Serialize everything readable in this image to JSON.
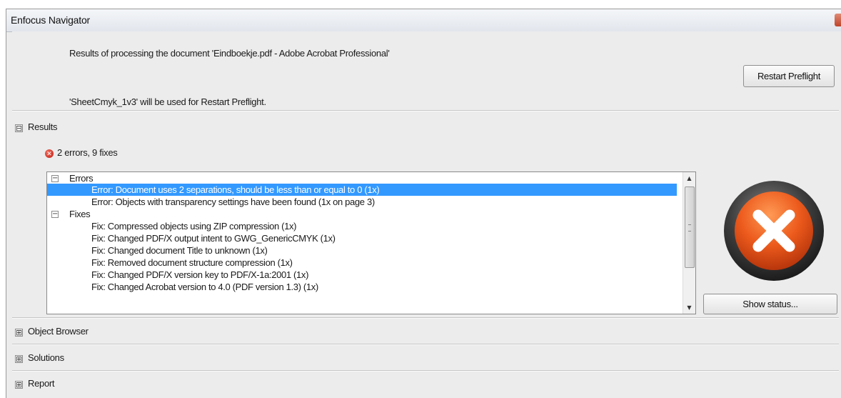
{
  "window": {
    "title": "Enfocus Navigator"
  },
  "header": {
    "document_line": "Results of processing the document 'Eindboekje.pdf - Adobe Acrobat Professional'",
    "profile_line": "'SheetCmyk_1v3' will be used for Restart Preflight.",
    "restart_button": "Restart Preflight"
  },
  "sections": {
    "results": {
      "label": "Results",
      "expander": "⊟"
    },
    "object_browser": {
      "label": "Object Browser",
      "expander": "⊞"
    },
    "solutions": {
      "label": "Solutions",
      "expander": "⊞"
    },
    "report": {
      "label": "Report",
      "expander": "⊞"
    }
  },
  "results": {
    "summary": "2 errors, 9 fixes",
    "groups": {
      "errors": {
        "label": "Errors",
        "items": [
          "Error: Document uses 2 separations, should be less than or equal to 0 (1x)",
          "Error: Objects with transparency settings have been found (1x on page 3)"
        ]
      },
      "fixes": {
        "label": "Fixes",
        "items": [
          "Fix: Compressed objects using ZIP compression (1x)",
          "Fix: Changed PDF/X output intent to GWG_GenericCMYK (1x)",
          "Fix: Changed document Title to unknown (1x)",
          "Fix: Removed document structure compression (1x)",
          "Fix: Changed PDF/X version key to PDF/X-1a:2001 (1x)",
          "Fix: Changed Acrobat version to 4.0 (PDF version 1.3) (1x)"
        ]
      }
    },
    "selected_index": 0,
    "show_status_button": "Show status..."
  },
  "colors": {
    "selection": "#3399ff",
    "error_badge_outer": "#4a4a4a",
    "error_badge_fill": "#e8501a",
    "error_icon": "#d0201a"
  },
  "icons": {
    "status": "error-x-icon",
    "summary": "error-icon"
  }
}
